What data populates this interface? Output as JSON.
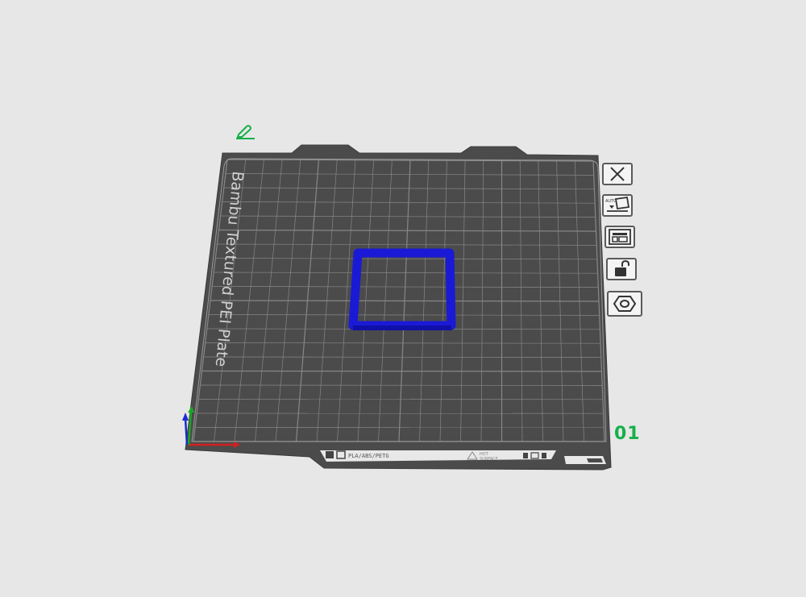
{
  "plate": {
    "name": "Bambu Textured PEI Plate",
    "number": "01",
    "material_label": "PLA/ABS/PETG",
    "hot_surface_label_line1": "HOT",
    "hot_surface_label_line2": "SURFACE"
  },
  "side_buttons": [
    {
      "name": "close-icon",
      "label": "close"
    },
    {
      "name": "auto-orient-icon",
      "label": "AUTO"
    },
    {
      "name": "arrange-icon",
      "label": "arrange"
    },
    {
      "name": "lock-icon",
      "label": "lock"
    },
    {
      "name": "plate-settings-icon",
      "label": "settings"
    }
  ],
  "colors": {
    "background": "#e7e7e7",
    "plate": "#4b4b4b",
    "grid": "#8a8a8a",
    "object": "#1a1ad6",
    "accent_green": "#16b04a",
    "axis_x": "#d42020",
    "axis_y": "#1aa820",
    "axis_z": "#1e2ad0"
  }
}
